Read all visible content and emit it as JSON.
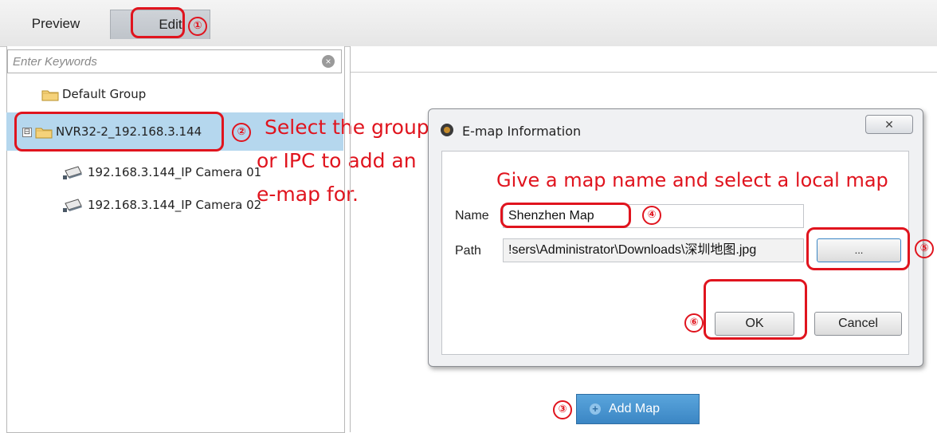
{
  "tabs": {
    "preview": "Preview",
    "edit": "Edit"
  },
  "search": {
    "placeholder": "Enter Keywords",
    "clear_icon": "clear-icon"
  },
  "tree": {
    "items": [
      {
        "label": "Default Group",
        "icon": "folder-icon"
      },
      {
        "label": "NVR32-2_192.168.3.144",
        "icon": "folder-icon",
        "expander": "⊟",
        "selected": true
      },
      {
        "label": "192.168.3.144_IP Camera 01",
        "icon": "camera-icon"
      },
      {
        "label": "192.168.3.144_IP Camera 02",
        "icon": "camera-icon"
      }
    ]
  },
  "annotations": {
    "step1": "①",
    "step2": "②",
    "step3": "③",
    "step4": "④",
    "step5": "⑤",
    "step6": "⑥",
    "select_line1": "Select the group",
    "select_line2": "or IPC to add an",
    "select_line3": "e-map for.",
    "dialog_hint": "Give a map name and select a local map"
  },
  "dialog": {
    "title": "E-map Information",
    "close_label": "✕",
    "name_label": "Name",
    "name_value": "Shenzhen Map",
    "path_label": "Path",
    "path_value": "!sers\\Administrator\\Downloads\\深圳地图.jpg",
    "browse_label": "...",
    "ok_label": "OK",
    "cancel_label": "Cancel"
  },
  "add_map": {
    "label": "Add Map"
  },
  "colors": {
    "annotation_red": "#e0141e",
    "selected_row": "#b5d7ee",
    "add_map_blue": "#3b86c4"
  }
}
